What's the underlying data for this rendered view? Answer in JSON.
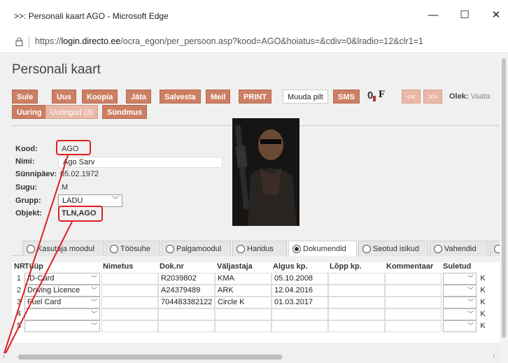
{
  "window": {
    "title": ">>: Personali kaart AGO - Microsoft Edge",
    "minimize": "—",
    "maximize": "☐",
    "close": "✕"
  },
  "address": {
    "url_prefix": "https://",
    "url_host": "login.directo.ee",
    "url_path": "/ocra_egon/per_persoon.asp?kood=AGO&hoiatus=&cdiv=0&lradio=12&clr1=1"
  },
  "page": {
    "title": "Personali kaart"
  },
  "toolbar": {
    "buttons": [
      "Sule",
      "Uus",
      "Koopia",
      "Jäta",
      "Salvesta",
      "Meil",
      "PRINT"
    ],
    "muuda_pilt": "Muuda pilt",
    "sms": "SMS",
    "attach_glyph": "0",
    "f_glyph": "F",
    "prev": "<<",
    "next": ">>",
    "olek_label": "Olek:",
    "olek_value": "Vaata",
    "row2": [
      "Uuring",
      "Uuringud (3)",
      "Sündmus"
    ]
  },
  "form": {
    "kood_label": "Kood:",
    "kood_value": "AGO",
    "nimi_label": "Nimi:",
    "nimi_value": "Ago Sarv",
    "synni_label": "Sünnipäev:",
    "synni_value": "05.02.1972",
    "sugu_label": "Sugu:",
    "sugu_value": "M",
    "grupp_label": "Grupp:",
    "grupp_value": "LADU",
    "objekt_label": "Objekt:",
    "objekt_value": "TLN,AGO"
  },
  "tabs": [
    {
      "label": "Kasutaja moodul",
      "active": false
    },
    {
      "label": "Töösuhe",
      "active": false
    },
    {
      "label": "Palgamoodul",
      "active": false
    },
    {
      "label": "Haridus",
      "active": false
    },
    {
      "label": "Dokumendid",
      "active": true
    },
    {
      "label": "Seotud isikud",
      "active": false
    },
    {
      "label": "Vahendid",
      "active": false
    }
  ],
  "table": {
    "headers": {
      "nr": "NR",
      "tyyp": "Tüüp",
      "nimetus": "Nimetus",
      "doknr": "Dok.nr",
      "valjastaja": "Väljastaja",
      "algus": "Algus kp.",
      "lopp": "Lõpp kp.",
      "kommentaar": "Kommentaar",
      "suletud": "Suletud"
    },
    "rows": [
      {
        "nr": "1",
        "tyyp": "ID-Card",
        "nimetus": "",
        "doknr": "R2039802",
        "valjastaja": "KMA",
        "algus": "05.10.2008",
        "lopp": "",
        "kommentaar": "",
        "k": "K"
      },
      {
        "nr": "2",
        "tyyp": "Driving Licence",
        "nimetus": "",
        "doknr": "A24379489",
        "valjastaja": "ARK",
        "algus": "12.04.2016",
        "lopp": "",
        "kommentaar": "",
        "k": "K"
      },
      {
        "nr": "3",
        "tyyp": "Fuel Card",
        "nimetus": "",
        "doknr": "704483382122",
        "valjastaja": "Circle K",
        "algus": "01.03.2017",
        "lopp": "",
        "kommentaar": "",
        "k": "K"
      },
      {
        "nr": "4",
        "tyyp": "",
        "nimetus": "",
        "doknr": "",
        "valjastaja": "",
        "algus": "",
        "lopp": "",
        "kommentaar": "",
        "k": "K"
      },
      {
        "nr": "5",
        "tyyp": "",
        "nimetus": "",
        "doknr": "",
        "valjastaja": "",
        "algus": "",
        "lopp": "",
        "kommentaar": "",
        "k": "K"
      }
    ]
  },
  "colors": {
    "button": "#cd7f63",
    "annotation": "#e02020"
  }
}
